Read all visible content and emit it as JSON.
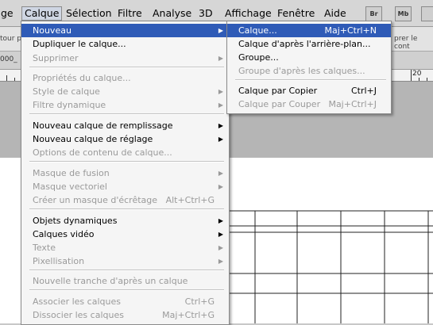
{
  "menubar": {
    "items": [
      "ge",
      "Calque",
      "Sélection",
      "Filtre",
      "Analyse",
      "3D",
      "Affichage",
      "Fenêtre",
      "Aide"
    ],
    "br_label": "Br",
    "mb_label": "Mb"
  },
  "optbar": {
    "left_text": "tour p",
    "right_text": "prer le cont"
  },
  "doctab": {
    "label": "000_"
  },
  "ruler": {
    "mark": "20"
  },
  "calque_menu": {
    "items": [
      {
        "label": "Nouveau",
        "shortcut": "",
        "submenu": true,
        "disabled": false,
        "highlighted": true
      },
      {
        "label": "Dupliquer le calque...",
        "shortcut": "",
        "submenu": false,
        "disabled": false
      },
      {
        "label": "Supprimer",
        "shortcut": "",
        "submenu": true,
        "disabled": true
      },
      {
        "label": "Propriétés du calque...",
        "shortcut": "",
        "submenu": false,
        "disabled": true
      },
      {
        "label": "Style de calque",
        "shortcut": "",
        "submenu": true,
        "disabled": true
      },
      {
        "label": "Filtre dynamique",
        "shortcut": "",
        "submenu": true,
        "disabled": true
      },
      {
        "label": "Nouveau calque de remplissage",
        "shortcut": "",
        "submenu": true,
        "disabled": false
      },
      {
        "label": "Nouveau calque de réglage",
        "shortcut": "",
        "submenu": true,
        "disabled": false
      },
      {
        "label": "Options de contenu de calque...",
        "shortcut": "",
        "submenu": false,
        "disabled": true
      },
      {
        "label": "Masque de fusion",
        "shortcut": "",
        "submenu": true,
        "disabled": true
      },
      {
        "label": "Masque vectoriel",
        "shortcut": "",
        "submenu": true,
        "disabled": true
      },
      {
        "label": "Créer un masque d'écrêtage",
        "shortcut": "Alt+Ctrl+G",
        "submenu": false,
        "disabled": true
      },
      {
        "label": "Objets dynamiques",
        "shortcut": "",
        "submenu": true,
        "disabled": false
      },
      {
        "label": "Calques vidéo",
        "shortcut": "",
        "submenu": true,
        "disabled": false
      },
      {
        "label": "Texte",
        "shortcut": "",
        "submenu": true,
        "disabled": true
      },
      {
        "label": "Pixellisation",
        "shortcut": "",
        "submenu": true,
        "disabled": true
      },
      {
        "label": "Nouvelle tranche d'après un calque",
        "shortcut": "",
        "submenu": false,
        "disabled": true
      },
      {
        "label": "Associer les calques",
        "shortcut": "Ctrl+G",
        "submenu": false,
        "disabled": true
      },
      {
        "label": "Dissocier les calques",
        "shortcut": "Maj+Ctrl+G",
        "submenu": false,
        "disabled": true
      }
    ]
  },
  "nouveau_menu": {
    "items": [
      {
        "label": "Calque...",
        "shortcut": "Maj+Ctrl+N",
        "disabled": false,
        "highlighted": true
      },
      {
        "label": "Calque d'après l'arrière-plan...",
        "shortcut": "",
        "disabled": false
      },
      {
        "label": "Groupe...",
        "shortcut": "",
        "disabled": false
      },
      {
        "label": "Groupe d'après les calques...",
        "shortcut": "",
        "disabled": true
      },
      {
        "label": "Calque par Copier",
        "shortcut": "Ctrl+J",
        "disabled": false
      },
      {
        "label": "Calque par Couper",
        "shortcut": "Maj+Ctrl+J",
        "disabled": true
      }
    ]
  },
  "icons": {
    "submenu_arrow": "▶"
  }
}
